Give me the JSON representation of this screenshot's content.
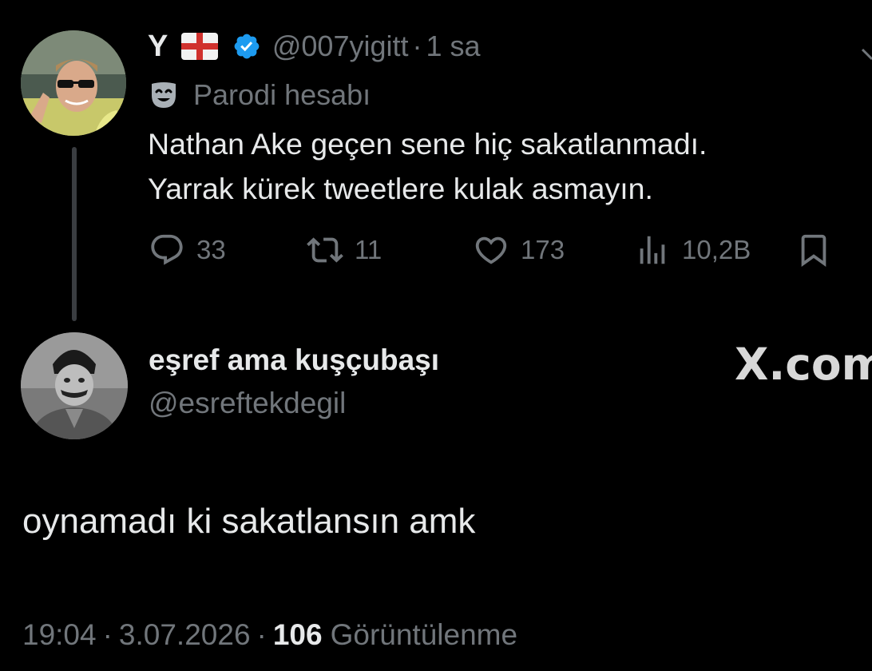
{
  "tweet": {
    "author_name": "Y",
    "flag_icon": "england-flag-icon",
    "verified_icon": "verified-badge-icon",
    "handle": "@007yigitt",
    "separator": "·",
    "time": "1 sa",
    "parody_icon": "parody-mask-icon",
    "parody_label": "Parodi hesabı",
    "text_lines": [
      "Nathan Ake geçen sene hiç sakatlanmadı.",
      "Yarrak kürek tweetlere kulak asmayın."
    ],
    "actions": {
      "replies": "33",
      "retweets": "11",
      "likes": "173",
      "views": "10,2B"
    }
  },
  "reply": {
    "author_name": "eşref ama kuşçubaşı",
    "handle": "@esreftekdegil",
    "watermark": "X.com",
    "text": "oynamadı ki sakatlansın amk",
    "time": "19:04",
    "date": "3.07.2026",
    "separator": "·",
    "views_count": "106",
    "views_label": "Görüntülenme"
  },
  "colors": {
    "background": "#000000",
    "text_primary": "#e7e9ea",
    "text_secondary": "#71767b",
    "verified_blue": "#1d9bf0",
    "thread_line": "#3a3d41"
  }
}
